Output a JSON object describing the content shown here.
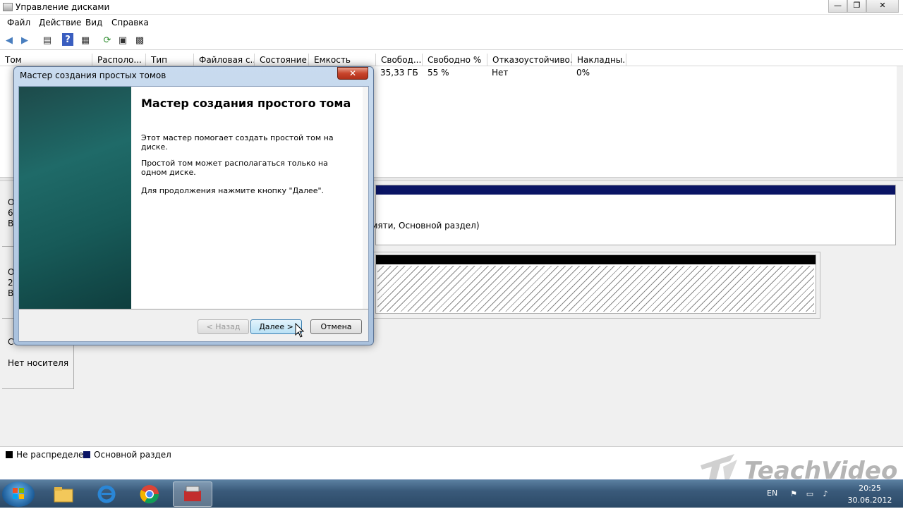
{
  "window": {
    "title": "Управление дисками",
    "minimize": "—",
    "maximize": "❐",
    "close": "✕"
  },
  "menu": [
    "Файл",
    "Действие",
    "Вид",
    "Справка"
  ],
  "toolbar_icons": [
    "back-icon",
    "forward-icon",
    "list-view-icon",
    "help-icon",
    "properties-icon",
    "refresh-icon",
    "rescan-icon",
    "settings-icon"
  ],
  "columns": [
    "Том",
    "Располо...",
    "Тип",
    "Файловая с...",
    "Состояние",
    "Емкость",
    "Свобод...",
    "Свободно %",
    "Отказоустойчиво...",
    "Накладны..."
  ],
  "row": {
    "free": "35,33 ГБ",
    "free_pct": "55 %",
    "fault_tolerance": "Нет",
    "overhead": "0%"
  },
  "disks": {
    "disk0_lines": [
      "О",
      "6",
      "В"
    ],
    "disk1_lines": [
      "О",
      "2",
      "В"
    ],
    "disk2_lines": [
      "С"
    ],
    "no_media": "Нет носителя",
    "partition_text": "амяти, Основной раздел)"
  },
  "legend": {
    "unallocated": "Не распределен",
    "primary": "Основной раздел",
    "unallocated_color": "#000000",
    "primary_color": "#0a1464"
  },
  "dialog": {
    "title": "Мастер создания простых томов",
    "close": "✕",
    "heading": "Мастер создания простого тома",
    "p1": "Этот мастер помогает создать простой том на диске.",
    "p2": "Простой том может располагаться только на одном диске.",
    "p3": "Для продолжения нажмите кнопку \"Далее\".",
    "back": "< Назад",
    "next": "Далее >",
    "cancel": "Отмена"
  },
  "taskbar": {
    "apps": [
      "explorer-icon",
      "ie-icon",
      "chrome-icon",
      "disk-management-icon"
    ],
    "lang": "EN",
    "time": "20:25",
    "date": "30.06.2012"
  },
  "watermark": {
    "brand": "TeachVideo"
  }
}
